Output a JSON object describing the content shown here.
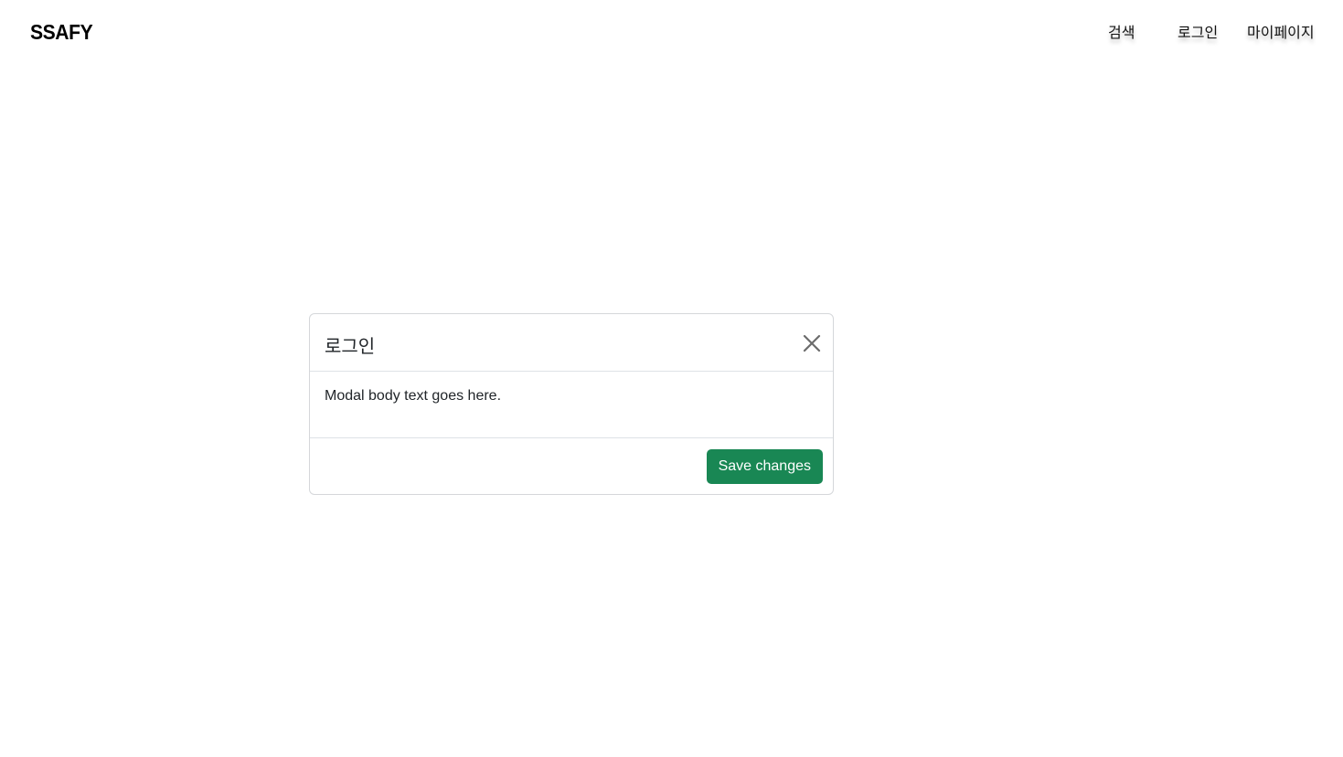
{
  "navbar": {
    "brand": "SSAFY",
    "links": [
      {
        "label": "검색"
      },
      {
        "label": "로그인"
      },
      {
        "label": "마이페이지"
      }
    ]
  },
  "modal": {
    "title": "로그인",
    "close_icon": "close-icon",
    "body_text": "Modal body text goes here.",
    "save_label": "Save changes"
  },
  "colors": {
    "primary_button": "#198754",
    "text": "#212529",
    "border": "#dee2e6"
  }
}
